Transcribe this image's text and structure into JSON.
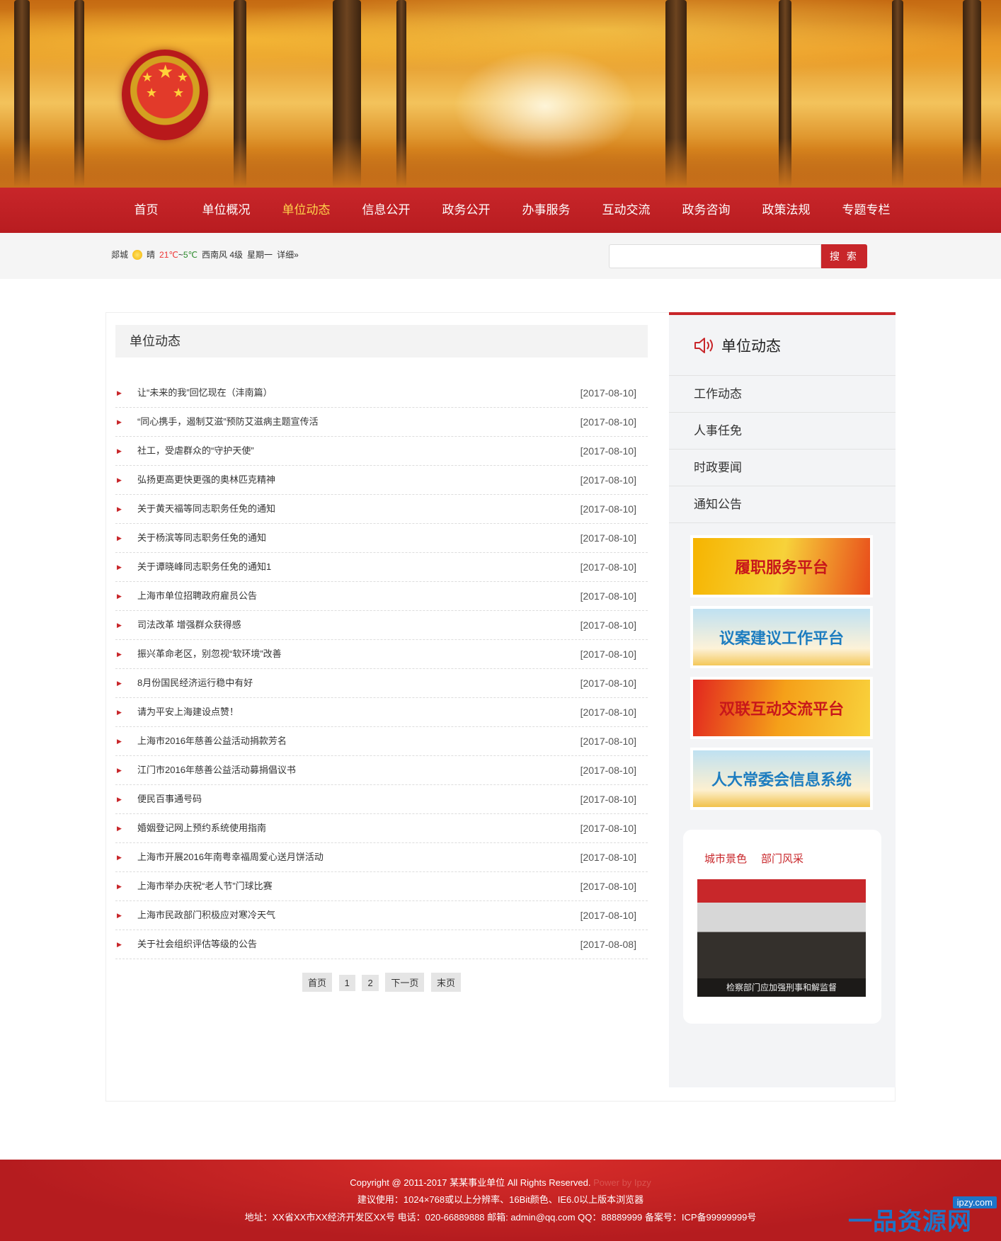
{
  "nav": {
    "items": [
      "首页",
      "单位概况",
      "单位动态",
      "信息公开",
      "政务公开",
      "办事服务",
      "互动交流",
      "政务咨询",
      "政策法规",
      "专题专栏"
    ],
    "active_index": 2
  },
  "weather": {
    "city": "郯城",
    "condition": "晴",
    "temp_high": "21℃",
    "separator": "~",
    "temp_low": "5℃",
    "wind": "西南风 4级",
    "weekday": "星期一",
    "details_link": "详细»"
  },
  "search": {
    "placeholder": "",
    "button_label": "搜 索"
  },
  "main": {
    "heading": "单位动态",
    "news": [
      {
        "title": "让“未来的我”回忆现在（沣南篇）",
        "date": "[2017-08-10]"
      },
      {
        "title": "“同心携手，遏制艾滋”预防艾滋病主题宣传活",
        "date": "[2017-08-10]"
      },
      {
        "title": "社工，受虐群众的“守护天使”",
        "date": "[2017-08-10]"
      },
      {
        "title": "弘扬更高更快更强的奥林匹克精神",
        "date": "[2017-08-10]"
      },
      {
        "title": "关于黄天福等同志职务任免的通知",
        "date": "[2017-08-10]"
      },
      {
        "title": "关于杨滨等同志职务任免的通知",
        "date": "[2017-08-10]"
      },
      {
        "title": "关于谭晓峰同志职务任免的通知1",
        "date": "[2017-08-10]"
      },
      {
        "title": "上海市单位招聘政府雇员公告",
        "date": "[2017-08-10]"
      },
      {
        "title": "司法改革 增强群众获得感",
        "date": "[2017-08-10]"
      },
      {
        "title": "振兴革命老区，别忽视“软环境”改善",
        "date": "[2017-08-10]"
      },
      {
        "title": "8月份国民经济运行稳中有好",
        "date": "[2017-08-10]"
      },
      {
        "title": "请为平安上海建设点赞！",
        "date": "[2017-08-10]"
      },
      {
        "title": "上海市2016年慈善公益活动捐款芳名",
        "date": "[2017-08-10]"
      },
      {
        "title": "江门市2016年慈善公益活动募捐倡议书",
        "date": "[2017-08-10]"
      },
      {
        "title": "便民百事通号码",
        "date": "[2017-08-10]"
      },
      {
        "title": "婚姻登记网上预约系统使用指南",
        "date": "[2017-08-10]"
      },
      {
        "title": "上海市开展2016年南粤幸福周爱心送月饼活动",
        "date": "[2017-08-10]"
      },
      {
        "title": "上海市举办庆祝“老人节”门球比赛",
        "date": "[2017-08-10]"
      },
      {
        "title": "上海市民政部门积极应对寒冷天气",
        "date": "[2017-08-10]"
      },
      {
        "title": "关于社会组织评估等级的公告",
        "date": "[2017-08-08]"
      }
    ],
    "pager": {
      "first": "首页",
      "page1": "1",
      "page2": "2",
      "next": "下一页",
      "last": "末页"
    }
  },
  "sidebar": {
    "heading": "单位动态",
    "menu": [
      "工作动态",
      "人事任免",
      "时政要闻",
      "通知公告"
    ],
    "platforms": [
      "履职服务平台",
      "议案建议工作平台",
      "双联互动交流平台",
      "人大常委会信息系统"
    ],
    "photo_tabs": [
      "城市景色",
      "部门风采"
    ],
    "photo_caption": "检察部门应加强刑事和解监督"
  },
  "footer": {
    "copyright": "Copyright @ 2011-2017 某某事业单位 All Rights Reserved.",
    "power": "Power by Ipzy",
    "advice": "建议使用：1024×768或以上分辨率、16Bit颜色、IE6.0以上版本浏览器",
    "address": "地址：XX省XX市XX经济开发区XX号 电话：020-66889888 邮箱: admin@qq.com QQ：88889999 备案号：ICP备99999999号"
  },
  "watermark": {
    "brand": "一品资源网",
    "url": "ipzy.com"
  },
  "colors": {
    "brand_red": "#c8262a",
    "nav_active": "#ffd24a"
  }
}
